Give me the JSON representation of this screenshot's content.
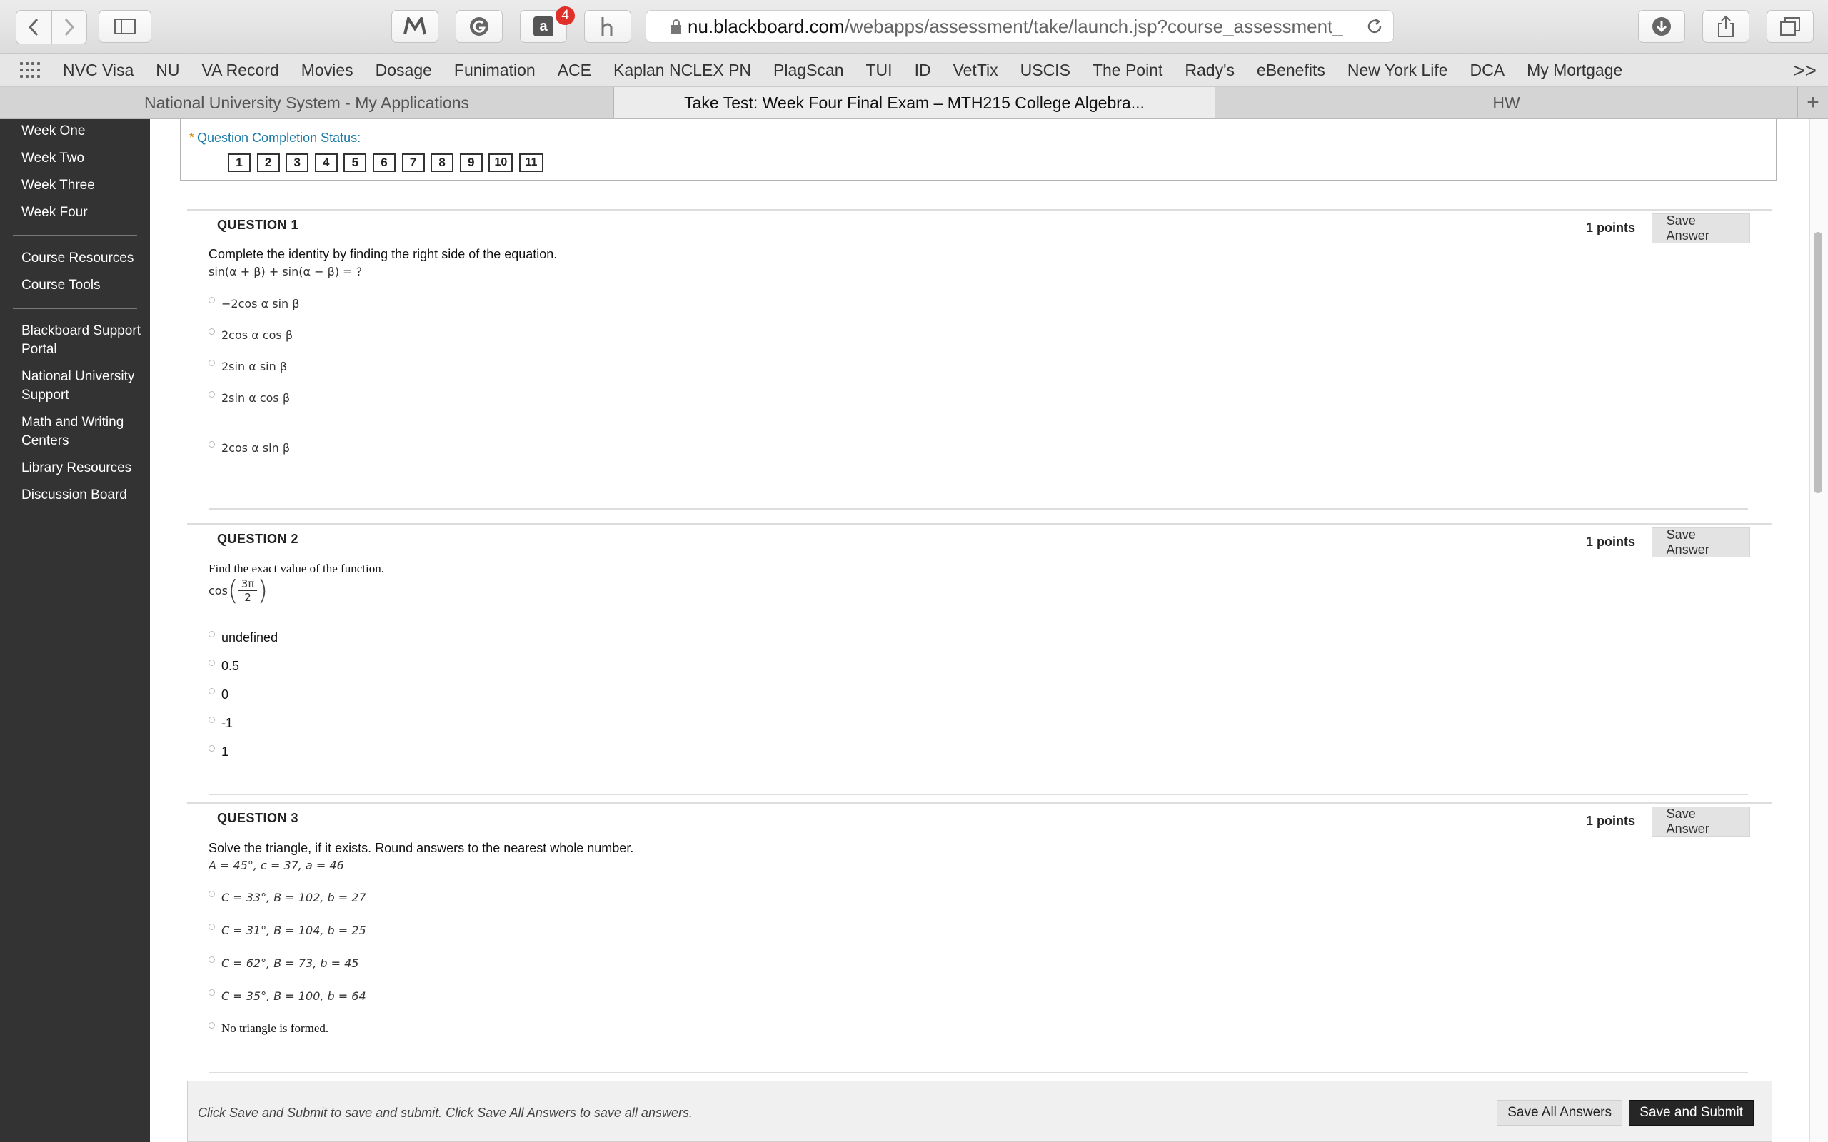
{
  "browser": {
    "url_host": "nu.blackboard.com",
    "url_path": "/webapps/assessment/take/launch.jsp?course_assessment_",
    "extension_badge": "4",
    "bookmarks": [
      "NVC Visa",
      "NU",
      "VA Record",
      "Movies",
      "Dosage",
      "Funimation",
      "ACE",
      "Kaplan NCLEX PN",
      "PlagScan",
      "TUI",
      "ID",
      "VetTix",
      "USCIS",
      "The Point",
      "Rady's",
      "eBenefits",
      "New York Life",
      "DCA",
      "My Mortgage"
    ],
    "more_bookmarks": ">>",
    "tabs": [
      "National University System - My Applications",
      "Take Test: Week Four Final Exam – MTH215 College Algebra...",
      "HW"
    ],
    "new_tab": "+"
  },
  "sidebar": {
    "group1": [
      "Week One",
      "Week Two",
      "Week Three",
      "Week Four"
    ],
    "group2": [
      "Course Resources",
      "Course Tools"
    ],
    "group3": [
      "Blackboard Support Portal",
      "National University Support",
      "Math and Writing Centers",
      "Library Resources",
      "Discussion Board"
    ]
  },
  "status": {
    "label": "Question Completion Status:",
    "question_numbers": [
      "1",
      "2",
      "3",
      "4",
      "5",
      "6",
      "7",
      "8",
      "9",
      "10",
      "11"
    ]
  },
  "questions": [
    {
      "header": "QUESTION 1",
      "points": "1 points",
      "save_label": "Save Answer",
      "text": "Complete the identity by finding the right side of the equation.",
      "expression": "sin(α + β) + sin(α − β) = ?",
      "options": [
        "−2cos α sin β",
        "2cos α cos β",
        "2sin α sin β",
        "2sin α cos β",
        "2cos α sin β"
      ]
    },
    {
      "header": "QUESTION 2",
      "points": "1 points",
      "save_label": "Save Answer",
      "text": "Find the exact value of the function.",
      "expression_func": "cos",
      "expression_num": "3π",
      "expression_den": "2",
      "options": [
        "undefined",
        "0.5",
        "0",
        "-1",
        "1"
      ]
    },
    {
      "header": "QUESTION 3",
      "points": "1 points",
      "save_label": "Save Answer",
      "text": "Solve the triangle, if it exists. Round answers to the nearest whole number.",
      "expression": "A = 45°, c = 37, a = 46",
      "options": [
        "C = 33°, B = 102, b = 27",
        "C = 31°, B = 104, b = 25",
        "C = 62°, B = 73, b = 45",
        "C = 35°, B = 100, b = 64",
        "No triangle is formed."
      ]
    }
  ],
  "footer": {
    "message": "Click Save and Submit to save and submit. Click Save All Answers to save all answers.",
    "save_all_label": "Save All Answers",
    "submit_label": "Save and Submit"
  },
  "colors": {
    "sidebar_bg": "#333333",
    "status_link": "#1a7aa8",
    "submit_bg": "#262626",
    "badge": "#e0302a"
  }
}
